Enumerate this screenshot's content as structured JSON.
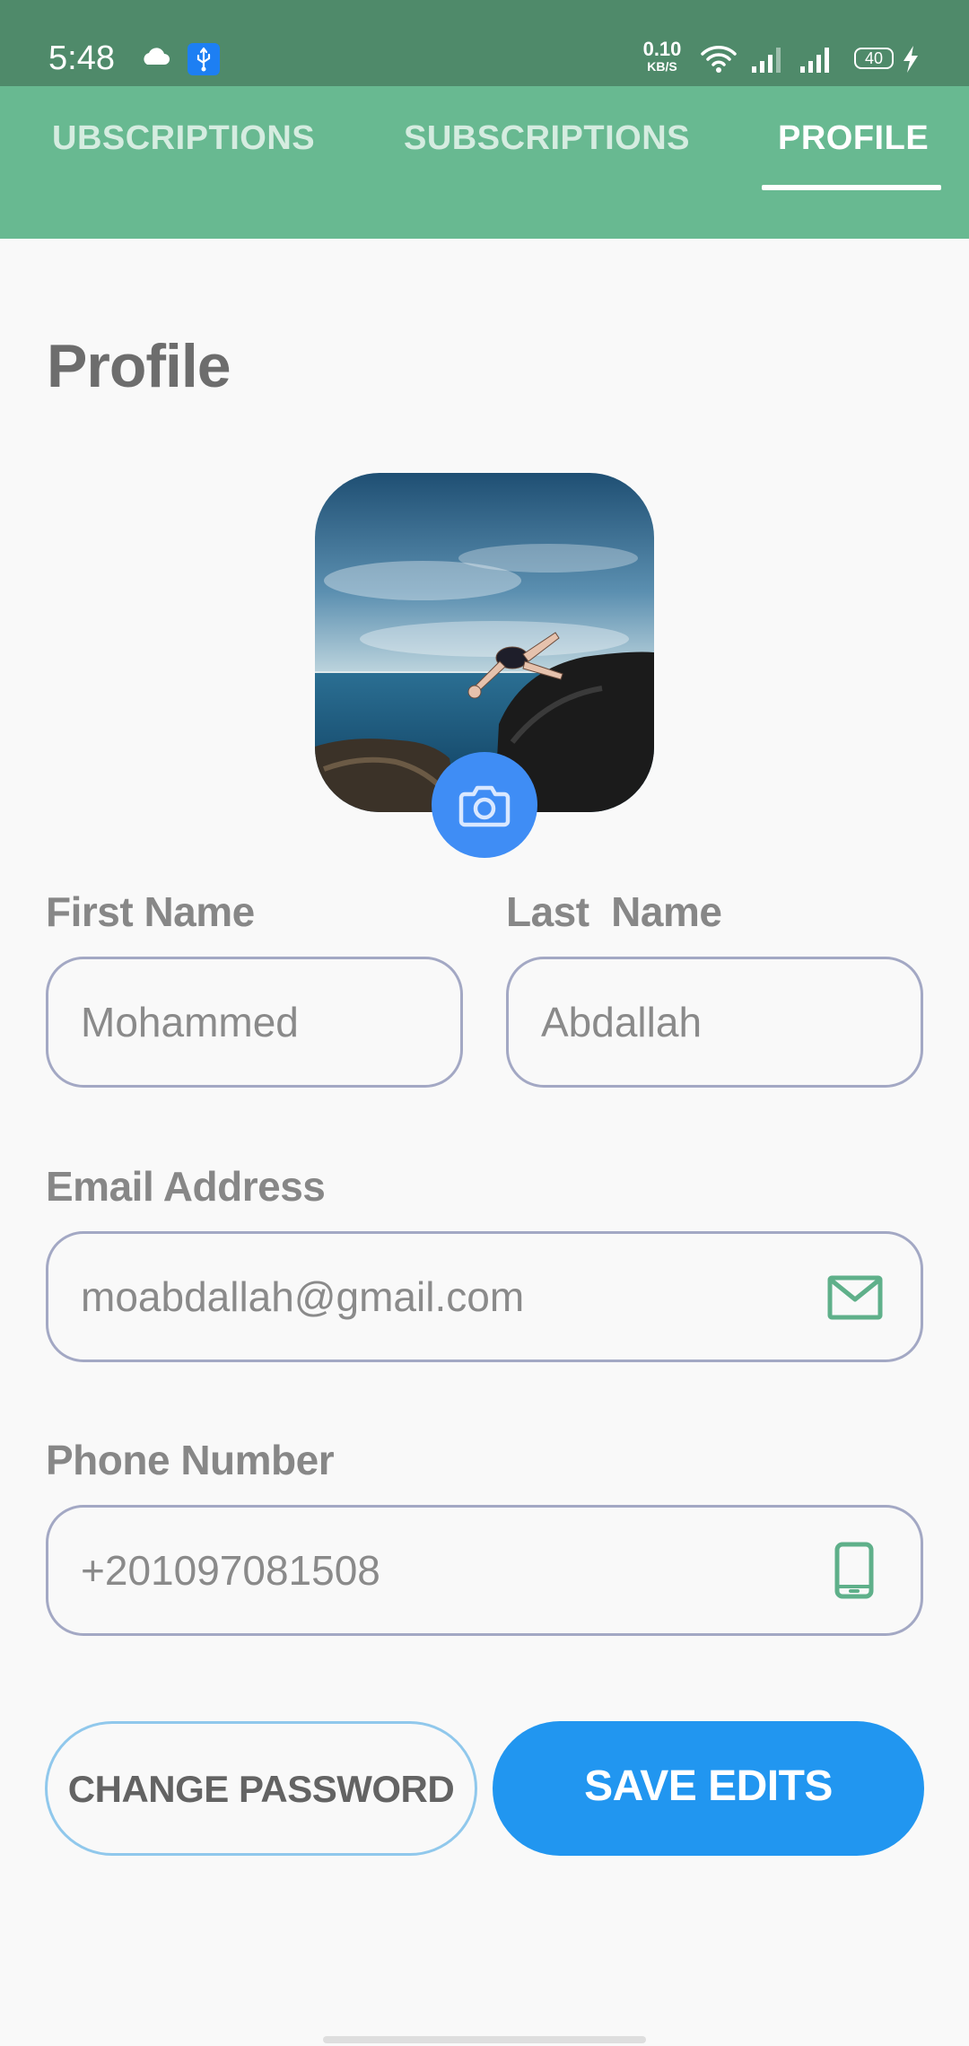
{
  "status_bar": {
    "time": "5:48",
    "network_speed_value": "0.10",
    "network_speed_unit": "KB/S",
    "battery_level": "40",
    "icons": [
      "cloud-icon",
      "usb-icon",
      "wifi-icon",
      "signal-icon",
      "signal-icon",
      "battery-icon",
      "charging-bolt-icon"
    ]
  },
  "tabs": [
    {
      "label": "UBSCRIPTIONS",
      "active": false
    },
    {
      "label": "SUBSCRIPTIONS",
      "active": false
    },
    {
      "label": "PROFILE",
      "active": true
    }
  ],
  "page": {
    "title": "Profile"
  },
  "avatar": {
    "edit_icon": "camera-icon"
  },
  "form": {
    "first_name": {
      "label": "First Name",
      "value": "Mohammed"
    },
    "last_name": {
      "label": "Last  Name",
      "value": "Abdallah"
    },
    "email": {
      "label": "Email Address",
      "value": "moabdallah@gmail.com",
      "icon": "mail-icon"
    },
    "phone": {
      "label": "Phone Number",
      "value": "+201097081508",
      "icon": "phone-icon"
    }
  },
  "actions": {
    "change_password": "CHANGE PASSWORD",
    "save_edits": "SAVE EDITS"
  },
  "colors": {
    "status_bar": "#4f8a6a",
    "tab_bar": "#68b991",
    "primary_button": "#2196f0",
    "camera_button": "#3f8df5",
    "field_icon": "#5fb08a",
    "field_border": "#a3a8c4"
  }
}
